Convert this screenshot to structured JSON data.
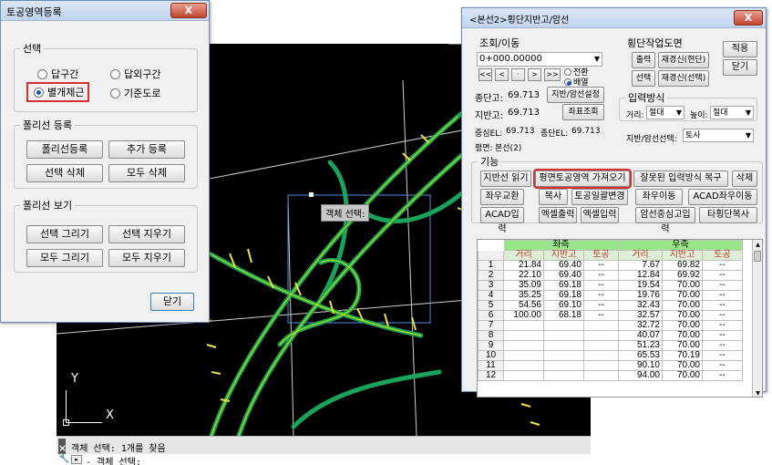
{
  "cad": {
    "tooltip": "객체 선택:",
    "ucs_y": "Y",
    "ucs_x": "X",
    "cmd_history": "객체 선택: 1개를 찾음",
    "cmd_prompt": "- 객체 선택:",
    "cmd_close": "×",
    "cmd_wrench": "🔧",
    "cmd_icon": "▸"
  },
  "left_dialog": {
    "title": "토공영역등록",
    "close": "X",
    "selection": {
      "legend": "선택",
      "options": [
        "답구간",
        "답외구간",
        "별개제근",
        "기준도로"
      ],
      "selected_index": 2
    },
    "polyline_register": {
      "legend": "폴리선 등록",
      "buttons": [
        "폴리선등록",
        "추가 등록",
        "선택 삭제",
        "모두 삭제"
      ]
    },
    "polyline_view": {
      "legend": "폴리선 보기",
      "buttons": [
        "선택 그리기",
        "선택 지우기",
        "모두 그리기",
        "모두 지우기"
      ]
    },
    "close_button": "닫기"
  },
  "right_dialog": {
    "title": "<본선2>횡단지반고/암선",
    "close": "X",
    "nav": {
      "legend": "조회/이동",
      "station": "0+000.00000",
      "buttons": [
        "<<",
        "<",
        "·",
        ">",
        ">>"
      ],
      "radio_options": [
        "전환",
        "배열"
      ],
      "radio_selected": 1,
      "terminal_label": "종단고:",
      "terminal_value": "69.713",
      "ground_label": "지반고:",
      "ground_value": "69.713",
      "btn_ground_set": "지반/암선설정",
      "btn_coord": "좌표조회",
      "center_el_label": "중심EL:",
      "center_el_value": "69.713",
      "terminal_el_label": "종단EL:",
      "terminal_el_value": "69.713",
      "plan_label": "평면:",
      "plan_value": "본선(2)"
    },
    "work": {
      "legend": "횡단작업도면",
      "btn_output": "출력",
      "btn_regen_status": "재경신(현단)",
      "btn_select": "선택",
      "btn_regen_select": "재경신(선택)",
      "btn_apply": "적용",
      "btn_close": "닫기"
    },
    "input": {
      "legend": "입력방식",
      "distance_label": "거리:",
      "distance_value": "절대",
      "height_label": "높이:",
      "height_value": "절대",
      "select_label": "지반/암선선택:",
      "select_value": "토사"
    },
    "functions": {
      "legend": "기능",
      "row1": [
        "지반선 읽기",
        "평면토공영역 가져오기",
        "잘못된 입력방식 복구",
        "삭제"
      ],
      "row2": [
        "좌우교환",
        "복사",
        "토공일괄변경",
        "좌우이동",
        "ACAD좌우이동"
      ],
      "row3": [
        "ACAD입력",
        "엑셀출력",
        "엑셀입력",
        "암선중심고입력",
        "타횡단복사"
      ]
    },
    "table": {
      "left_group": "좌측",
      "right_group": "우측",
      "columns": [
        "거리",
        "지반고",
        "토공"
      ],
      "rows": [
        {
          "n": "1",
          "ld": "21.84",
          "lg": "69.40",
          "lt": "--",
          "rd": "7.67",
          "rg": "69.82",
          "rt": "--"
        },
        {
          "n": "2",
          "ld": "22.10",
          "lg": "69.40",
          "lt": "--",
          "rd": "12.84",
          "rg": "69.92",
          "rt": "--"
        },
        {
          "n": "3",
          "ld": "35.09",
          "lg": "69.18",
          "lt": "--",
          "rd": "19.54",
          "rg": "70.00",
          "rt": "--"
        },
        {
          "n": "4",
          "ld": "35.25",
          "lg": "69.18",
          "lt": "--",
          "rd": "19.76",
          "rg": "70.00",
          "rt": "--"
        },
        {
          "n": "5",
          "ld": "54.56",
          "lg": "69.10",
          "lt": "--",
          "rd": "32.43",
          "rg": "70.00",
          "rt": "--"
        },
        {
          "n": "6",
          "ld": "100.00",
          "lg": "68.18",
          "lt": "--",
          "rd": "32.57",
          "rg": "70.00",
          "rt": "--"
        },
        {
          "n": "7",
          "ld": "",
          "lg": "",
          "lt": "",
          "rd": "32.72",
          "rg": "70.00",
          "rt": "--"
        },
        {
          "n": "8",
          "ld": "",
          "lg": "",
          "lt": "",
          "rd": "40.07",
          "rg": "70.00",
          "rt": "--"
        },
        {
          "n": "9",
          "ld": "",
          "lg": "",
          "lt": "",
          "rd": "51.23",
          "rg": "70.00",
          "rt": "--"
        },
        {
          "n": "10",
          "ld": "",
          "lg": "",
          "lt": "",
          "rd": "65.53",
          "rg": "70.19",
          "rt": "--"
        },
        {
          "n": "11",
          "ld": "",
          "lg": "",
          "lt": "",
          "rd": "90.10",
          "rg": "70.00",
          "rt": "--"
        },
        {
          "n": "12",
          "ld": "",
          "lg": "",
          "lt": "",
          "rd": "94.00",
          "rg": "70.00",
          "rt": "--"
        }
      ]
    }
  }
}
